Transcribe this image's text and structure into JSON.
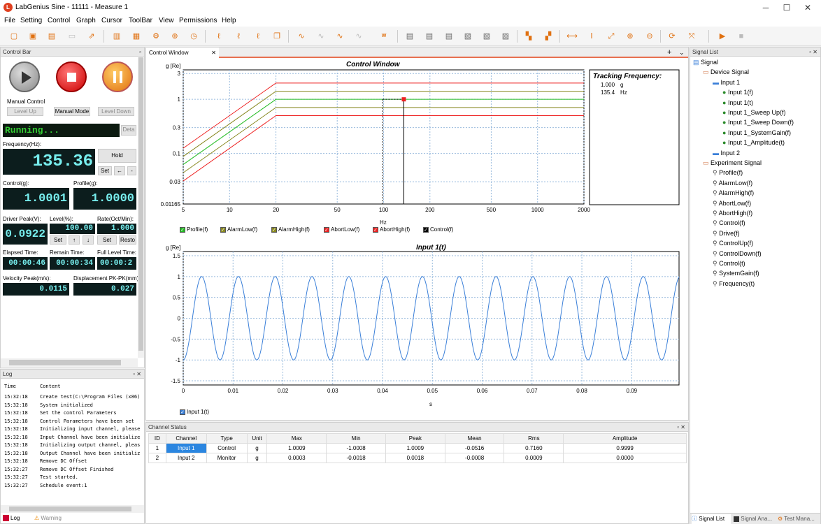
{
  "window": {
    "title": "LabGenius Sine - 11111 - Measure 1",
    "app_icon": "labgenius-logo"
  },
  "menu": [
    "File",
    "Setting",
    "Control",
    "Graph",
    "Cursor",
    "ToolBar",
    "View",
    "Permissions",
    "Help"
  ],
  "tabs": {
    "control_bar": "Control Bar",
    "control_window": "Control Window",
    "signal_list": "Signal List",
    "log": "Log",
    "channel_status": "Channel Status"
  },
  "control": {
    "manual_control": "Manual Control",
    "level_up": "Level Up",
    "manual_mode": "Manual Mode",
    "level_down": "Level Down",
    "status": "Running...",
    "detail": "Deta",
    "freq_label": "Frequency(Hz):",
    "freq": "135.36",
    "hold": "Hold",
    "set": "Set",
    "left_arrow": "←",
    "dash": "-",
    "control_label": "Control(g):",
    "control_val": "1.0001",
    "profile_label": "Profile(g):",
    "profile_val": "1.0000",
    "driver_label": "Driver Peak(V):",
    "driver_val": "0.0922",
    "level_label": "Level(%):",
    "level_val": "100.00",
    "rate_label": "Rate(Oct/Min):",
    "rate_val": "1.000",
    "up_arrow": "↑",
    "down_arrow": "↓",
    "restore": "Resto",
    "elapsed_label": "Elapsed Time:",
    "elapsed": "00:00:46",
    "remain_label": "Remain Time:",
    "remain": "00:00:34",
    "full_label": "Full Level Time:",
    "full": "00:00:2",
    "vel_label": "Velocity Peak(m/s):",
    "vel": "0.0115",
    "disp_label": "Displacement PK-PK(mm):",
    "disp": "0.027"
  },
  "log": {
    "headers": [
      "Time",
      "Content"
    ],
    "rows": [
      [
        "15:32:18",
        "Create test(C:\\Program Files (x86)"
      ],
      [
        "15:32:18",
        "System initialized"
      ],
      [
        "15:32:18",
        "Set the control Parameters"
      ],
      [
        "15:32:18",
        "Control Parameters have been set"
      ],
      [
        "15:32:18",
        "Initializing input channel, please"
      ],
      [
        "15:32:18",
        "Input Channel have been initialize"
      ],
      [
        "15:32:18",
        "Initializing output channel, pleas"
      ],
      [
        "15:32:18",
        "Output Channel have been initializ"
      ],
      [
        "15:32:18",
        "Remove DC Offset"
      ],
      [
        "15:32:27",
        "Remove DC Offset Finished"
      ],
      [
        "15:32:27",
        "Test started."
      ],
      [
        "15:32:27",
        "Schedule event:1"
      ]
    ],
    "tab_log": "Log",
    "tab_warning": "Warning"
  },
  "tracking": {
    "title": "Tracking Frequency:",
    "val1": "1.000",
    "unit1": "g",
    "val2": "135.4",
    "unit2": "Hz"
  },
  "chart_data": [
    {
      "type": "line",
      "title": "Control Window",
      "ylabel": "g [Re]",
      "xlabel": "Hz",
      "xscale": "log",
      "yscale": "log",
      "xticks": [
        "5",
        "10",
        "20",
        "50",
        "100",
        "200",
        "500",
        "1000",
        "2000"
      ],
      "yticks": [
        "3",
        "1",
        "0.3",
        "0.1",
        "0.03",
        "0.01165"
      ],
      "xlim": [
        5,
        2000
      ],
      "ylim": [
        0.01165,
        3.5
      ],
      "series": [
        {
          "name": "Profile(f)",
          "color": "#22bb22",
          "x": [
            5,
            20,
            2000
          ],
          "y": [
            0.0625,
            1,
            1
          ]
        },
        {
          "name": "AlarmLow(f)",
          "color": "#888820",
          "x": [
            5,
            20,
            2000
          ],
          "y": [
            0.044,
            0.707,
            0.707
          ]
        },
        {
          "name": "AlarmHigh(f)",
          "color": "#888820",
          "x": [
            5,
            20,
            2000
          ],
          "y": [
            0.088,
            1.41,
            1.41
          ]
        },
        {
          "name": "AbortLow(f)",
          "color": "#ee2222",
          "x": [
            5,
            20,
            2000
          ],
          "y": [
            0.031,
            0.5,
            0.5
          ]
        },
        {
          "name": "AbortHigh(f)",
          "color": "#ee2222",
          "x": [
            5,
            20,
            2000
          ],
          "y": [
            0.125,
            2,
            2
          ]
        },
        {
          "name": "Control(f)",
          "color": "#000000",
          "x": [
            135.4
          ],
          "y": [
            1.0
          ]
        }
      ],
      "cursor": {
        "x": 135.4,
        "y": 1.0
      }
    },
    {
      "type": "line",
      "title": "Input 1(t)",
      "ylabel": "g [Re]",
      "xlabel": "s",
      "xticks": [
        "0",
        "0.01",
        "0.02",
        "0.03",
        "0.04",
        "0.05",
        "0.06",
        "0.07",
        "0.08",
        "0.09"
      ],
      "yticks": [
        "1.5",
        "1",
        "0.5",
        "0",
        "-0.5",
        "-1",
        "-1.5"
      ],
      "xlim": [
        0,
        0.0995
      ],
      "ylim": [
        -1.6,
        1.6
      ],
      "series": [
        {
          "name": "Input 1(t)",
          "color": "#3a7fd8",
          "amplitude": 1.0,
          "frequency_hz": 135.4
        }
      ]
    }
  ],
  "channel_status": {
    "headers": [
      "ID",
      "Channel",
      "Type",
      "Unit",
      "Max",
      "Min",
      "Peak",
      "Mean",
      "Rms",
      "Amplitude"
    ],
    "rows": [
      [
        "1",
        "Input 1",
        "Control",
        "g",
        "1.0009",
        "-1.0008",
        "1.0009",
        "-0.0516",
        "0.7160",
        "0.9999"
      ],
      [
        "2",
        "Input 2",
        "Monitor",
        "g",
        "0.0003",
        "-0.0018",
        "0.0018",
        "-0.0008",
        "0.0009",
        "0.0000"
      ]
    ]
  },
  "signal_tree": {
    "root": "Signal",
    "device": "Device Signal",
    "input1": "Input 1",
    "input1_children": [
      "Input 1(f)",
      "Input 1(t)",
      "Input 1_Sweep Up(f)",
      "Input 1_Sweep Down(f)",
      "Input 1_SystemGain(f)",
      "Input 1_Amplitude(t)"
    ],
    "input2": "Input 2",
    "experiment": "Experiment Signal",
    "experiment_children": [
      "Profile(f)",
      "AlarmLow(f)",
      "AlarmHigh(f)",
      "AbortLow(f)",
      "AbortHigh(f)",
      "Control(f)",
      "Drive(f)",
      "ControlUp(f)",
      "ControlDown(f)",
      "Control(t)",
      "SystemGain(f)",
      "Frequency(t)"
    ]
  },
  "bottom_tabs": [
    "Signal List",
    "Signal Ana...",
    "Test Mana..."
  ]
}
